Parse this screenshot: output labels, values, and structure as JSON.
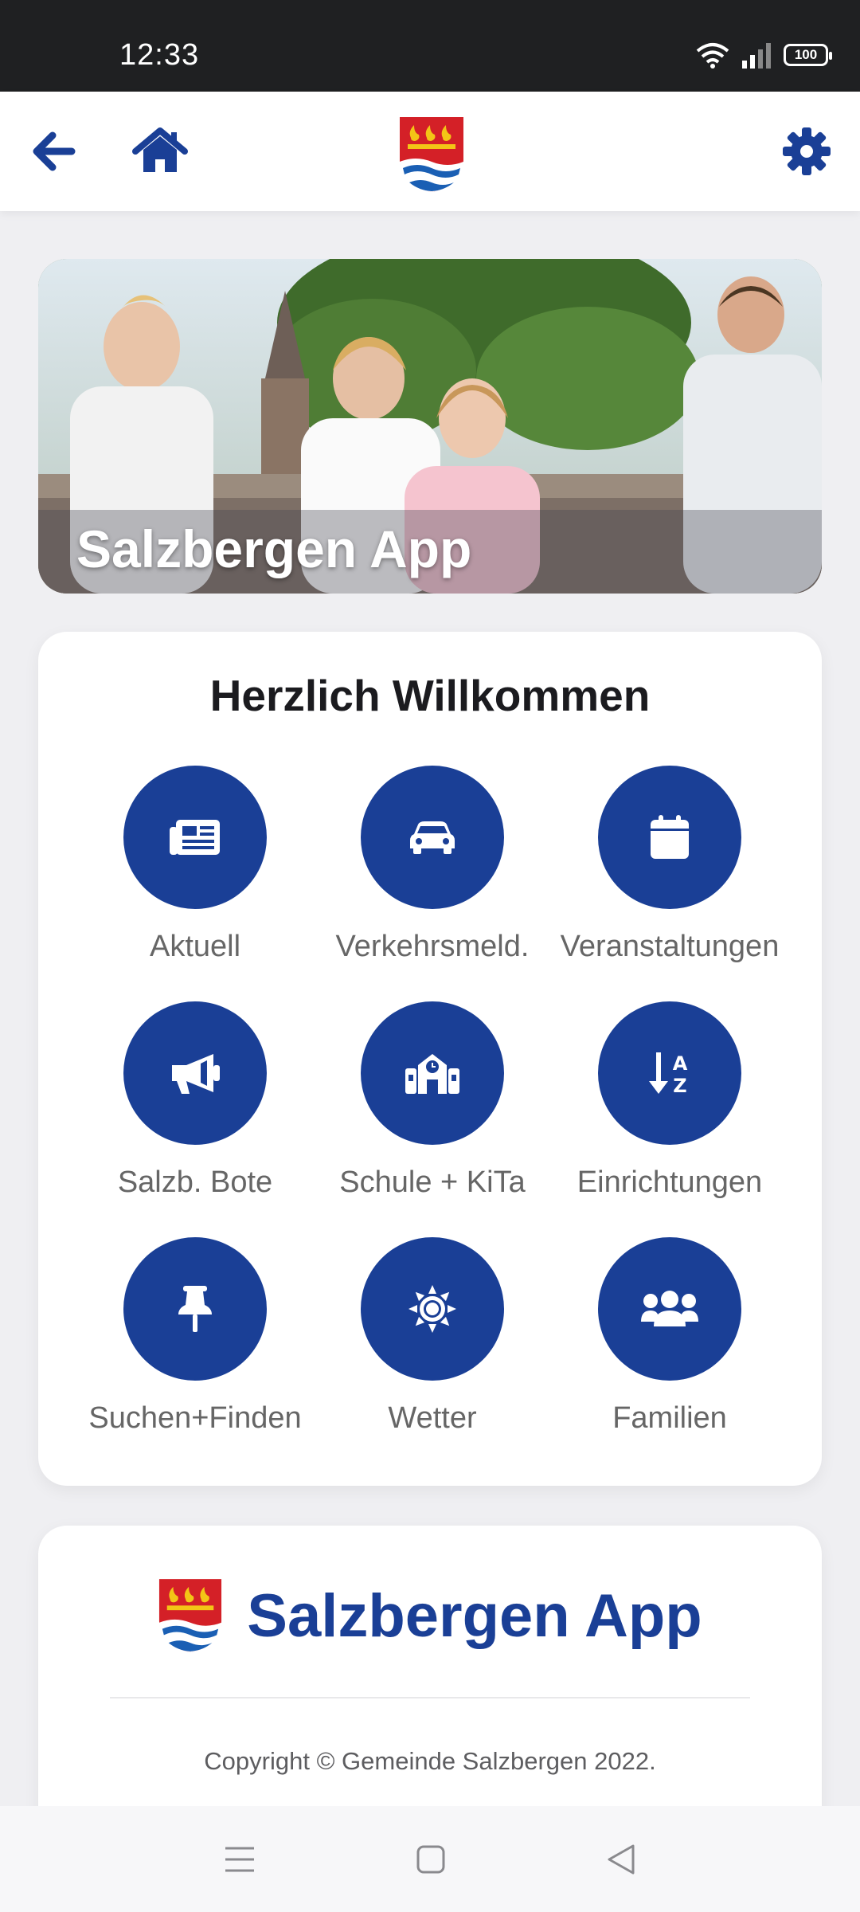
{
  "status_bar": {
    "time": "12:33",
    "battery": "100",
    "icons": [
      "wifi-icon",
      "signal-icon",
      "battery-icon"
    ]
  },
  "toolbar": {
    "back_icon": "arrow-left-icon",
    "home_icon": "home-icon",
    "logo": "salzbergen-crest",
    "settings_icon": "gear-icon"
  },
  "hero": {
    "title": "Salzbergen App"
  },
  "welcome": {
    "title": "Herzlich Willkommen",
    "tiles": [
      {
        "label": "Aktuell",
        "icon": "newspaper-icon"
      },
      {
        "label": "Verkehrsmeld.",
        "icon": "car-icon"
      },
      {
        "label": "Veranstaltungen",
        "icon": "calendar-icon"
      },
      {
        "label": "Salzb. Bote",
        "icon": "megaphone-icon"
      },
      {
        "label": "Schule + KiTa",
        "icon": "school-icon"
      },
      {
        "label": "Einrichtungen",
        "icon": "sort-alpha-icon"
      },
      {
        "label": "Suchen+Finden",
        "icon": "pin-icon"
      },
      {
        "label": "Wetter",
        "icon": "sun-icon"
      },
      {
        "label": "Familien",
        "icon": "users-icon"
      }
    ]
  },
  "footer": {
    "brand": "Salzbergen App",
    "copyright": "Copyright © Gemeinde Salzbergen 2022."
  },
  "nav": {
    "icons": [
      "menu-icon",
      "home-square-icon",
      "back-triangle-icon"
    ]
  },
  "colors": {
    "brand_blue": "#1a3f96",
    "status_bar": "#1f2022",
    "background": "#efeff2"
  }
}
